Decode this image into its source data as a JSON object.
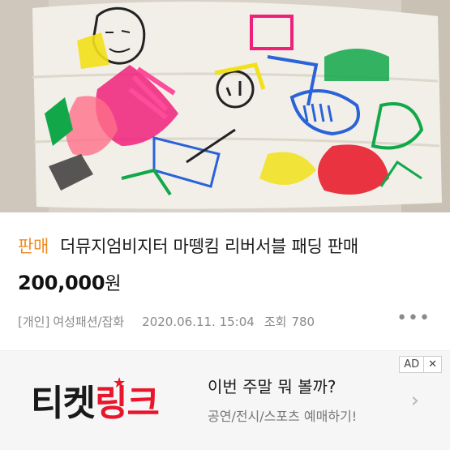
{
  "listing": {
    "badge": "판매",
    "title": "더뮤지엄비지터 마뗑킴 리버서블 패딩 판매",
    "price": "200,000",
    "price_unit": "원",
    "seller_type": "[개인]",
    "category": "여성패션/잡화",
    "date": "2020.06.11. 15:04",
    "views_label": "조회",
    "views": "780",
    "more_icon": "ellipsis-icon",
    "photo_icon": "product-photo"
  },
  "ad": {
    "label": "AD",
    "close": "✕",
    "logo_black": "티켓",
    "logo_red": "링크",
    "logo_star": "★",
    "headline": "이번 주말 뭐 볼까?",
    "subline": "공연/전시/스포츠 예매하기!",
    "chevron": "›",
    "accent": "#e8162c"
  }
}
